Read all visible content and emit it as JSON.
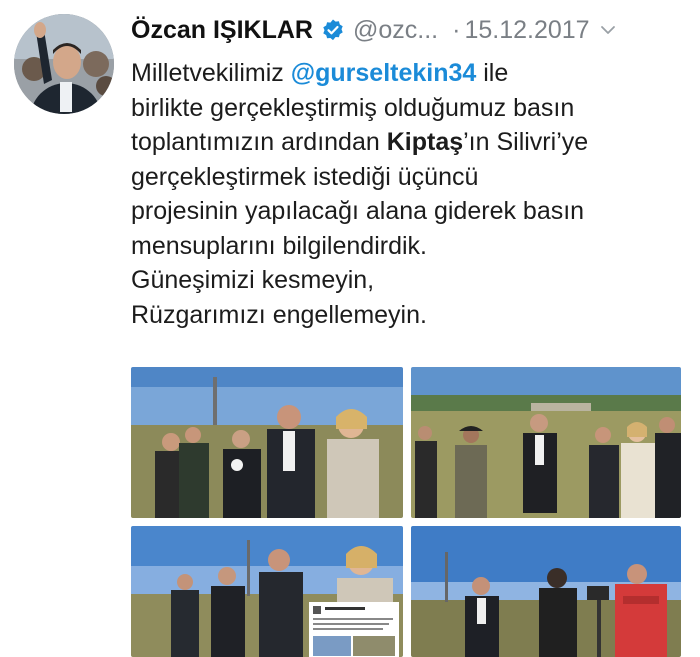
{
  "tweet": {
    "display_name": "Özcan IŞIKLAR",
    "handle": "@ozc...",
    "separator": "·",
    "date": "15.12.2017",
    "accent_color": "#1b8bd8",
    "verified_icon": "verified-badge-icon",
    "menu_icon": "chevron-down-icon",
    "lines": [
      {
        "pre": "Milletvekilimiz ",
        "mention": "@gurseltekin34",
        "post": " ile"
      },
      {
        "text": "birlikte gerçekleştirmiş olduğumuz basın"
      },
      {
        "pre": "toplantımızın ardından ",
        "bold": "Kiptaş",
        "post": "’ın Silivri’ye"
      },
      {
        "text": "gerçekleştirmek istediği üçüncü"
      },
      {
        "text": "projesinin yapılacağı alana giderek basın"
      },
      {
        "text": "mensuplarını bilgilendirdik."
      },
      {
        "text": "Güneşimizi kesmeyin,"
      },
      {
        "text": "Rüzgarımızı engellemeyin."
      }
    ]
  },
  "photos": [
    {
      "name": "press-photo-1"
    },
    {
      "name": "press-photo-2"
    },
    {
      "name": "press-photo-3"
    },
    {
      "name": "press-photo-4"
    }
  ]
}
